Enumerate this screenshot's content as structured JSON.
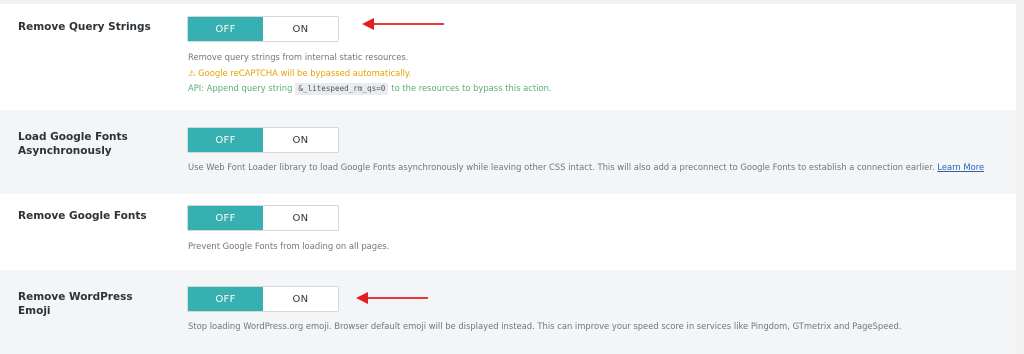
{
  "settings": [
    {
      "label": "Remove Query Strings",
      "toggle": {
        "off_label": "OFF",
        "on_label": "ON",
        "state": "OFF"
      },
      "description": "Remove query strings from internal static resources.",
      "warning": "⚠ Google reCAPTCHA will be bypassed automatically.",
      "api_prefix": "API: Append query string",
      "api_code": "&_litespeed_rm_qs=0",
      "api_suffix": "to the resources to bypass this action."
    },
    {
      "label": "Load Google Fonts Asynchronously",
      "toggle": {
        "off_label": "OFF",
        "on_label": "ON",
        "state": "OFF"
      },
      "description": "Use Web Font Loader library to load Google Fonts asynchronously while leaving other CSS intact. This will also add a preconnect to Google Fonts to establish a connection earlier.",
      "link": "Learn More"
    },
    {
      "label": "Remove Google Fonts",
      "toggle": {
        "off_label": "OFF",
        "on_label": "ON",
        "state": "OFF"
      },
      "description": "Prevent Google Fonts from loading on all pages."
    },
    {
      "label": "Remove WordPress Emoji",
      "toggle": {
        "off_label": "OFF",
        "on_label": "ON",
        "state": "OFF"
      },
      "description": "Stop loading WordPress.org emoji. Browser default emoji will be displayed instead. This can improve your speed score in services like Pingdom, GTmetrix and PageSpeed."
    }
  ],
  "colors": {
    "toggle_active": "#36b0b0",
    "arrow": "#e02020",
    "warning": "#e6a100",
    "api": "#5aab74",
    "link": "#2a64b8"
  }
}
